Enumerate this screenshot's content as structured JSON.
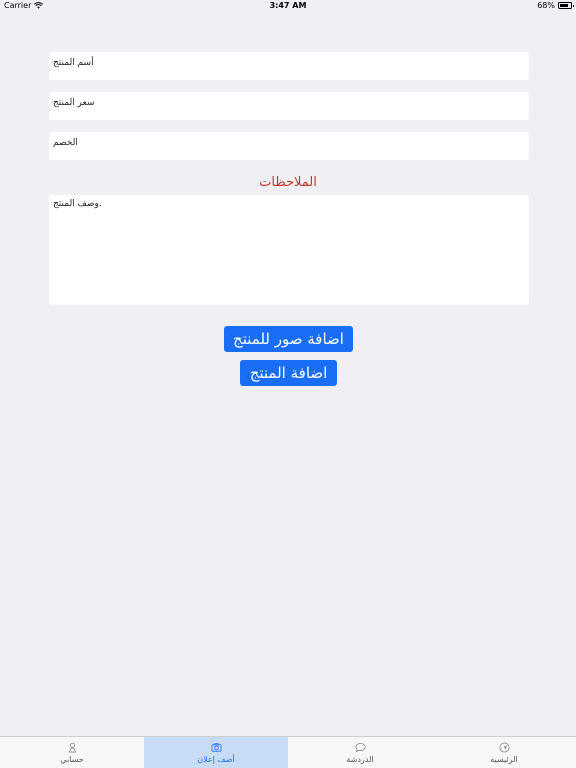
{
  "status_bar": {
    "carrier": "Carrier",
    "time": "3:47 AM",
    "battery": "68%"
  },
  "form": {
    "name_placeholder": "أسم المنتج",
    "price_placeholder": "سعر المنتج",
    "discount_placeholder": "الخصم",
    "notes_label": "الملاحظات",
    "notes_placeholder": "وصف المنتج."
  },
  "buttons": {
    "add_images": "اضافة صور للمنتج",
    "add_product": "اضافة المنتج"
  },
  "tabs": [
    {
      "label": "حسابي",
      "icon": "person-icon",
      "active": false
    },
    {
      "label": "أضف إعلان",
      "icon": "camera-icon",
      "active": true
    },
    {
      "label": "الدردشة",
      "icon": "chat-bubble-icon",
      "active": false
    },
    {
      "label": "الرئيسيه",
      "icon": "navigation-arrow-icon",
      "active": false
    }
  ],
  "colors": {
    "background": "#efeff4",
    "accent": "#1a6ef5",
    "notes_label": "#c0392b",
    "active_tab_bg": "#c9dcf7"
  }
}
